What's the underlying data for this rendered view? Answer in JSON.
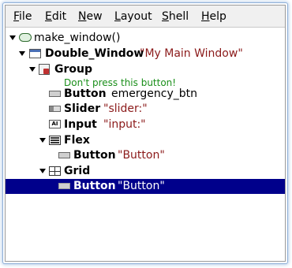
{
  "menu": {
    "items": [
      {
        "label": "File",
        "hot": "F",
        "rest": "ile"
      },
      {
        "label": "Edit",
        "hot": "E",
        "rest": "dit"
      },
      {
        "label": "New",
        "hot": "N",
        "rest": "ew"
      },
      {
        "label": "Layout",
        "hot": "L",
        "rest": "ayout"
      },
      {
        "label": "Shell",
        "hot": "S",
        "rest": "hell"
      },
      {
        "label": "Help",
        "hot": "H",
        "rest": "elp"
      }
    ]
  },
  "tree": {
    "root": {
      "label": "make_window()"
    },
    "window": {
      "type": "Double_Window",
      "value": "\"My Main Window\""
    },
    "group": {
      "type": "Group"
    },
    "button1": {
      "comment": "Don't press this button!",
      "type": "Button",
      "name": "emergency_btn"
    },
    "slider": {
      "type": "Slider",
      "value": "\"slider:\""
    },
    "input": {
      "type": "Input",
      "value": "\"input:\""
    },
    "flex": {
      "type": "Flex"
    },
    "button2": {
      "type": "Button",
      "value": "\"Button\""
    },
    "grid": {
      "type": "Grid"
    },
    "button3": {
      "type": "Button",
      "value": "\"Button\""
    }
  },
  "colors": {
    "selection": "#00008b",
    "string": "#8b1a1a",
    "comment": "#1a8f1a"
  }
}
